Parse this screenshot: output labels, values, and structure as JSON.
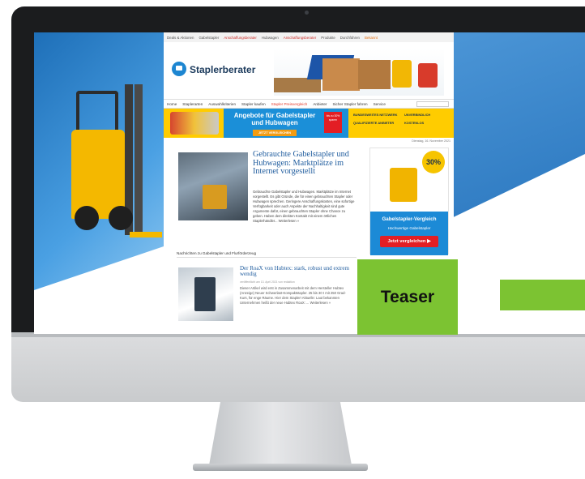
{
  "site": {
    "logo_text": "Staplerberater",
    "top_nav": [
      {
        "label": "Deals & Aktionen",
        "style": "normal"
      },
      {
        "label": "Gabelstapler",
        "style": "normal"
      },
      {
        "label": "Anschaffungsberater",
        "style": "red"
      },
      {
        "label": "Hubwagen",
        "style": "normal"
      },
      {
        "label": "Anschaffungsberater",
        "style": "red"
      },
      {
        "label": "Produkte",
        "style": "normal"
      },
      {
        "label": "Durchführen",
        "style": "normal"
      },
      {
        "label": "Bekannt",
        "style": "orange"
      }
    ],
    "main_nav": [
      {
        "label": "Home",
        "active": false
      },
      {
        "label": "Staplerarten",
        "active": false
      },
      {
        "label": "Auswahlkriterien",
        "active": false
      },
      {
        "label": "Stapler kaufen",
        "active": false
      },
      {
        "label": "Stapler Preisvergleich",
        "active": true
      },
      {
        "label": "Anbieter",
        "active": false
      },
      {
        "label": "Sicher Stapler fahren",
        "active": false
      },
      {
        "label": "Service",
        "active": false
      }
    ],
    "promo": {
      "headline": "Angebote für Gabelstapler und Hubwagen",
      "cta": "JETZT VERGLEICHEN",
      "badge": "bis zu 30% sparen",
      "benefits": [
        "BUNDESWEITES NETZWERK",
        "UNVERBINDLICH",
        "QUALIFIZIERTE ANBIETER",
        "KOSTENLOS"
      ]
    },
    "date_line": "Dienstag, 16. November 2021",
    "featured_article": {
      "title": "Gebrauchte Gabelstapler und Hubwagen: Marktplätze im Internet vorgestellt",
      "body": "Gebrauchte Gabelstapler und Hubwagen. Marktplätze im Internet vorgestellt. Es gibt Gründe, die für einen gebrauchten Stapler oder Hubwagen sprechen. Geringere Anschaffungskosten, eine sofortige Verfügbarkeit oder auch Aspekte der Nachhaltigkeit sind gute Argumente dafür, einen gebrauchten Stapler ohne Chance zu geben. Haben dem direkten Kontakt mit einem örtlichen Staplerhändler...",
      "more": "Weiterlesen »"
    },
    "section_title": "Nachrichten zu Gabelstapler und Flurförderzeug",
    "news_item": {
      "title": "Der RoaX von Hubtex: stark, robust und extrem wendig",
      "meta": "veröffentlicht am 13. April 2021 von redaktion",
      "body": "Dieser Artikel wird erst in Zusammenarbeit mit dem Hersteller Hubtex (Anzeige) Neuer Schwerlast-Kompaktstapler. 25 bis 30 t mit 250 Grad-Kurs, für enge Räume. Hier dem Stapler! Aktuelle: Laut bekannten Unternehmen heißt der neue Hubtex RoaX: ...",
      "more": "Weiterlesen »"
    },
    "sidebar_ad": {
      "badge_small": "bis zu",
      "badge": "30%",
      "title": "Gabelstapler-Vergleich",
      "subtitle": "Hochwertige Gabelstapler",
      "button": "Jetzt vergleichen ▶"
    }
  },
  "overlay": {
    "teaser_label": "Teaser"
  },
  "colors": {
    "teaser_green": "#7cc332",
    "brand_blue": "#1c8ad6",
    "accent_red": "#e31e24",
    "promo_yellow": "#ffcc00"
  }
}
